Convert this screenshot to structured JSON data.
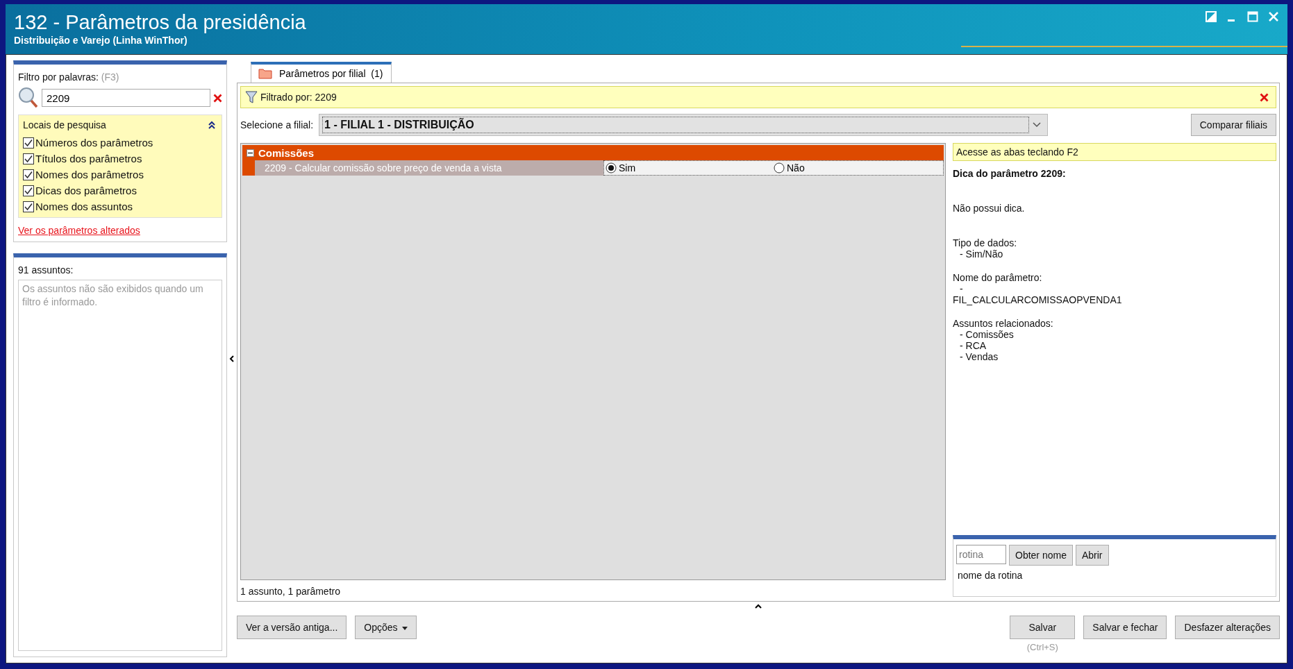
{
  "window": {
    "title": "132 - Parâmetros da presidência",
    "subtitle": "Distribuição e Varejo (Linha WinThor)"
  },
  "filter": {
    "label": "Filtro por palavras:",
    "shortcut": "(F3)",
    "value": "2209"
  },
  "search_locations": {
    "title": "Locais de pesquisa",
    "expanded": true,
    "options": [
      {
        "label": "Números dos parâmetros",
        "checked": true
      },
      {
        "label": "Títulos dos parâmetros",
        "checked": true
      },
      {
        "label": "Nomes dos parâmetros",
        "checked": true
      },
      {
        "label": "Dicas dos parâmetros",
        "checked": true
      },
      {
        "label": "Nomes dos assuntos",
        "checked": true
      }
    ]
  },
  "changed_link": "Ver os parâmetros alterados",
  "subjects": {
    "count": "91 assuntos:",
    "message": "Os assuntos não são exibidos quando um filtro é informado."
  },
  "tabs": [
    {
      "label": "Parâmetros por filial",
      "count": "(1)",
      "selected": true
    }
  ],
  "filter_bar": {
    "text": "Filtrado por: 2209"
  },
  "branch": {
    "label": "Selecione a filial:",
    "value": "1 - FILIAL 1 - DISTRIBUIÇÃO"
  },
  "compare_button": "Comparar filiais",
  "groups": [
    {
      "title": "Comissões",
      "expanded": true,
      "params": [
        {
          "label": "2209 - Calcular comissão sobre preço de venda a vista",
          "options": [
            {
              "label": "Sim",
              "selected": true
            },
            {
              "label": "Não",
              "selected": false
            }
          ]
        }
      ]
    }
  ],
  "status": "1 assunto, 1 parâmetro",
  "hint": {
    "banner": "Acesse as abas teclando F2",
    "title": "Dica do parâmetro 2209:",
    "text": "Não possui dica.",
    "sections": [
      {
        "heading": "Tipo de dados:",
        "items": [
          {
            "text": "- Sim/Não",
            "indented": true
          }
        ]
      },
      {
        "heading": "Nome do parâmetro:",
        "items": [
          {
            "text": "-",
            "indented": true
          },
          {
            "text": "FIL_CALCULARCOMISSAOPVENDA1",
            "indented": false
          }
        ]
      },
      {
        "heading": "Assuntos relacionados:",
        "items": [
          {
            "text": "- Comissões",
            "indented": true
          },
          {
            "text": "- RCA",
            "indented": true
          },
          {
            "text": "- Vendas",
            "indented": true
          }
        ]
      }
    ]
  },
  "routine": {
    "placeholder": "rotina",
    "buttons": [
      "Obter nome",
      "Abrir"
    ],
    "name": "nome da rotina"
  },
  "footer": {
    "left_buttons": [
      {
        "label": "Ver a versão antiga...",
        "dropdown": false
      },
      {
        "label": "Opções",
        "dropdown": true
      }
    ],
    "right_buttons": [
      {
        "label": "Salvar",
        "shortcut": "(Ctrl+S)"
      },
      {
        "label": "Salvar e fechar"
      },
      {
        "label": "Desfazer alterações"
      }
    ]
  }
}
